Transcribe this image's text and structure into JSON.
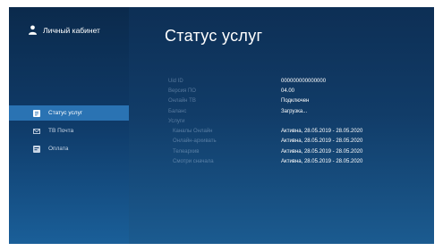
{
  "sidebar": {
    "profile_label": "Личный кабинет",
    "items": [
      {
        "label": "Статус услуг",
        "icon": "document-icon",
        "active": true
      },
      {
        "label": "ТВ Почта",
        "icon": "mail-icon",
        "active": false
      },
      {
        "label": "Оплата",
        "icon": "card-icon",
        "active": false
      }
    ]
  },
  "main": {
    "title": "Статус услуг",
    "rows": [
      {
        "label": "Uid ID",
        "value": "000000000000000"
      },
      {
        "label": "Версия ПО",
        "value": "04.00"
      },
      {
        "label": "Онлайн ТВ",
        "value": "Подключен"
      },
      {
        "label": "Баланс",
        "value": "Загрузка..."
      },
      {
        "label": "Услуги",
        "value": ""
      },
      {
        "label": "Каналы Онлайн",
        "value": "Активна, 28.05.2019 - 28.05.2020"
      },
      {
        "label": "Онлайн-архивать",
        "value": "Активна, 28.05.2019 - 28.05.2020"
      },
      {
        "label": "Телеархив",
        "value": "Активна, 28.05.2019 - 28.05.2020"
      },
      {
        "label": "Смотри сначала",
        "value": "Активна, 28.05.2019 - 28.05.2020"
      }
    ]
  }
}
